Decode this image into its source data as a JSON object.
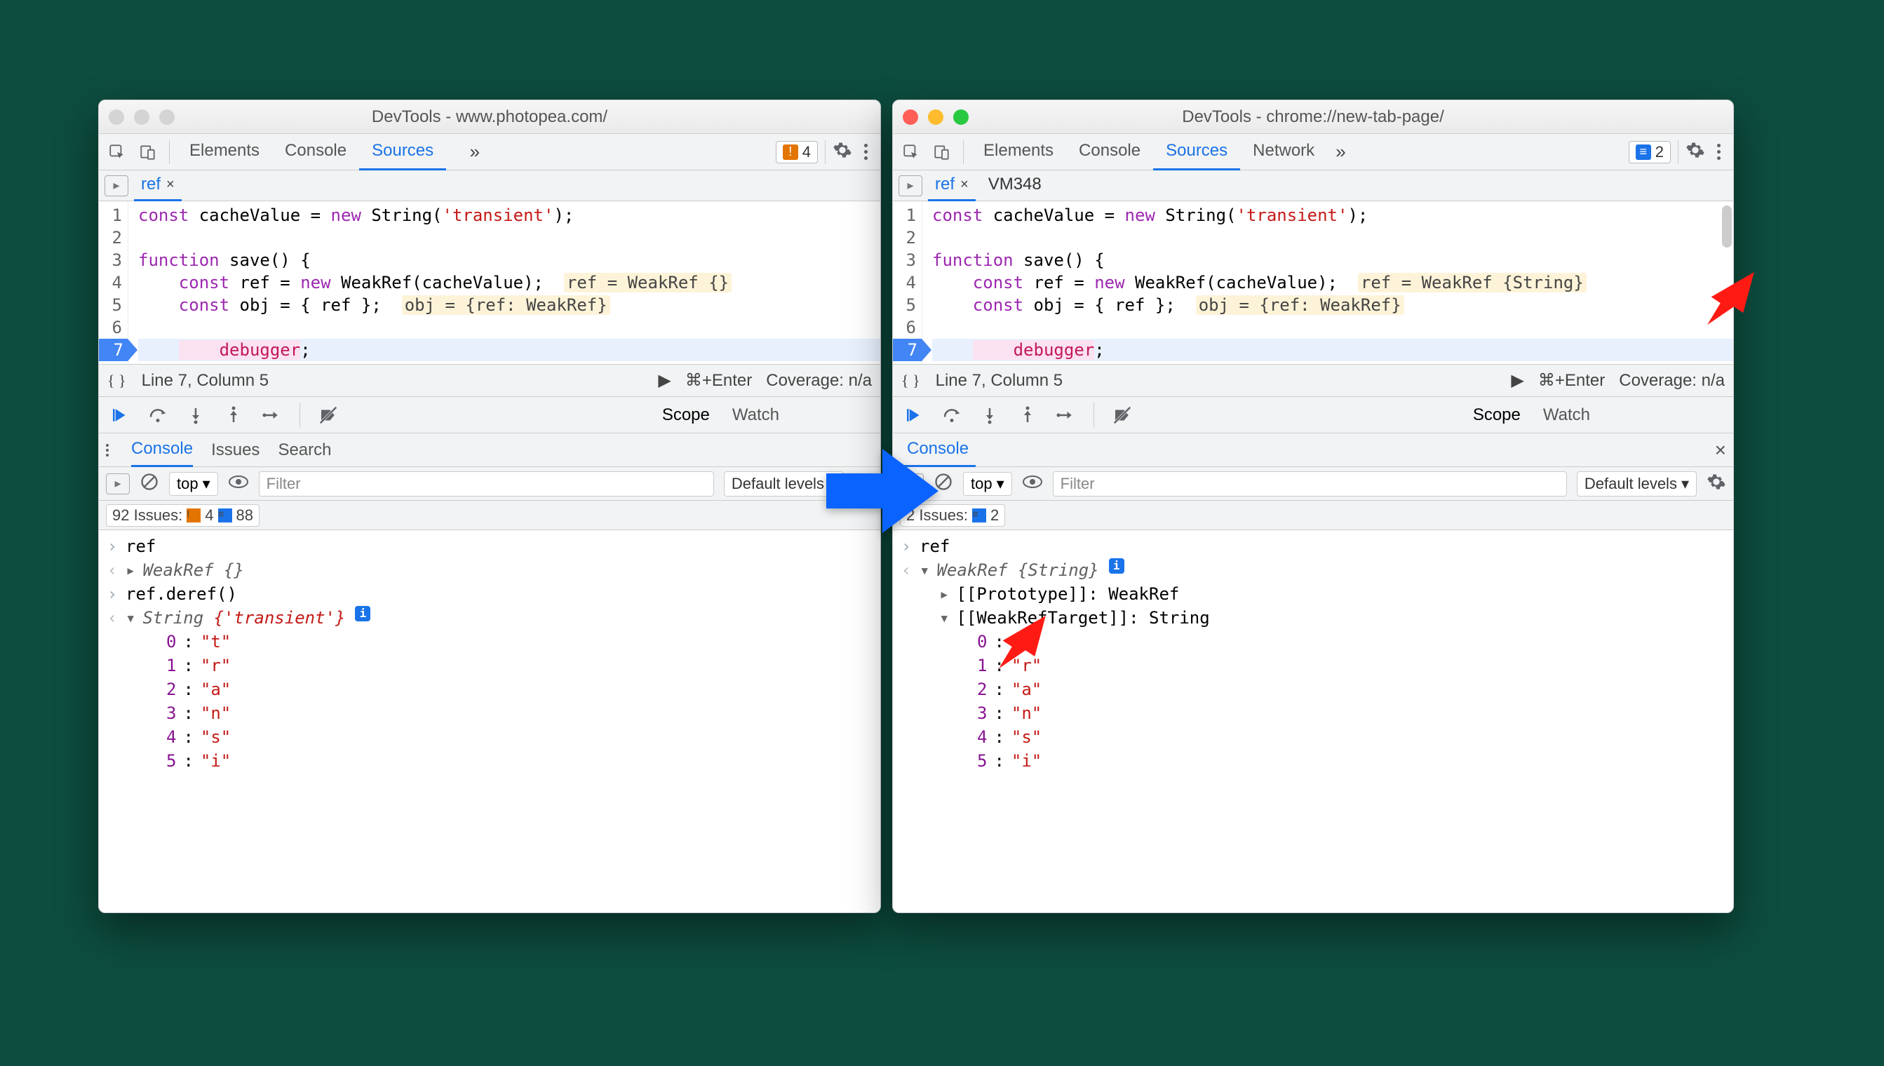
{
  "left": {
    "title": "DevTools - www.photopea.com/",
    "tabs": [
      "Elements",
      "Console",
      "Sources"
    ],
    "activeTab": "Sources",
    "warnCount": "4",
    "fileTabs": [
      {
        "name": "ref",
        "close": true
      }
    ],
    "code": {
      "lines": [
        "1",
        "2",
        "3",
        "4",
        "5",
        "6",
        "7"
      ],
      "l1a": "const",
      "l1b": " cacheValue = ",
      "l1c": "new",
      "l1d": " String(",
      "l1e": "'transient'",
      "l1f": ");",
      "l3a": "function",
      "l3b": " save() {",
      "l4a": "    const",
      "l4b": " ref = ",
      "l4c": "new",
      "l4d": " WeakRef(cacheValue);  ",
      "l4hint": "ref = WeakRef {}",
      "l5a": "    const",
      "l5b": " obj = { ref };  ",
      "l5hint": "obj = {ref: WeakRef}",
      "l7": "    debugger",
      "l7b": ";"
    },
    "status": {
      "pos": "Line 7, Column 5",
      "run": "⌘+Enter",
      "coverage": "Coverage: n/a"
    },
    "dbgTabs": [
      "Scope",
      "Watch"
    ],
    "drawerTabs": [
      "Console",
      "Issues",
      "Search"
    ],
    "console": {
      "context": "top",
      "filterPlaceholder": "Filter",
      "levels": "Default levels",
      "issuesText": "92 Issues:",
      "issuesWarn": "4",
      "issuesInfo": "88",
      "rows": {
        "r1": "ref",
        "r2": "WeakRef {}",
        "r3": "ref.deref()",
        "r4": "String {'transient'}",
        "chars": [
          {
            "k": "0",
            "v": "\"t\""
          },
          {
            "k": "1",
            "v": "\"r\""
          },
          {
            "k": "2",
            "v": "\"a\""
          },
          {
            "k": "3",
            "v": "\"n\""
          },
          {
            "k": "4",
            "v": "\"s\""
          },
          {
            "k": "5",
            "v": "\"i\""
          }
        ]
      }
    }
  },
  "right": {
    "title": "DevTools - chrome://new-tab-page/",
    "tabs": [
      "Elements",
      "Console",
      "Sources",
      "Network"
    ],
    "activeTab": "Sources",
    "infoCount": "2",
    "fileTabs": [
      {
        "name": "ref",
        "close": true
      },
      {
        "name": "VM348"
      }
    ],
    "code": {
      "l4hint": "ref = WeakRef {String}",
      "l5hint": "obj = {ref: WeakRef}"
    },
    "status": {
      "pos": "Line 7, Column 5",
      "run": "⌘+Enter",
      "coverage": "Coverage: n/a"
    },
    "dbgTabs": [
      "Scope",
      "Watch"
    ],
    "drawerTabs": [
      "Console"
    ],
    "console": {
      "context": "top",
      "filterPlaceholder": "Filter",
      "levels": "Default levels",
      "issuesText": "2 Issues:",
      "issuesInfo": "2",
      "rows": {
        "r1": "ref",
        "r2": "WeakRef {String}",
        "proto": "[[Prototype]]: ",
        "protoV": "WeakRef",
        "target": "[[WeakRefTarget]]: ",
        "targetV": "String",
        "chars": [
          {
            "k": "0",
            "v": "\"t\""
          },
          {
            "k": "1",
            "v": "\"r\""
          },
          {
            "k": "2",
            "v": "\"a\""
          },
          {
            "k": "3",
            "v": "\"n\""
          },
          {
            "k": "4",
            "v": "\"s\""
          },
          {
            "k": "5",
            "v": "\"i\""
          }
        ]
      }
    }
  }
}
